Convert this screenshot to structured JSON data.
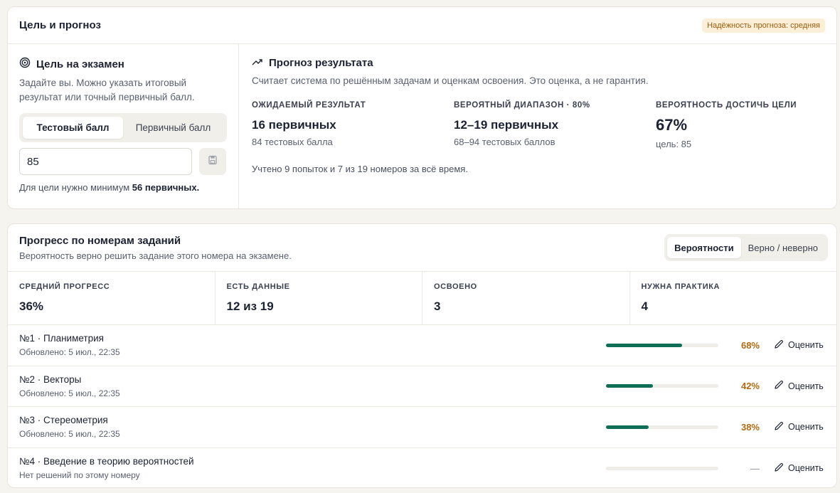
{
  "goal_card": {
    "title": "Цель и прогноз",
    "reliability_badge": "Надёжность прогноза: средняя"
  },
  "goal": {
    "title": "Цель на экзамен",
    "description": "Задайте вы. Можно указать итоговый результат или точный первичный балл.",
    "tabs": [
      {
        "label": "Тестовый балл",
        "active": true
      },
      {
        "label": "Первичный балл",
        "active": false
      }
    ],
    "input_value": "85",
    "hint_prefix": "Для цели нужно минимум",
    "hint_value": "56 первичных."
  },
  "forecast": {
    "title": "Прогноз результата",
    "description": "Считает система по решённым задачам и оценкам освоения. Это оценка, а не гарантия.",
    "stats": [
      {
        "label": "ОЖИДАЕМЫЙ РЕЗУЛЬТАТ",
        "value": "16 первичных",
        "sub": "84 тестовых балла"
      },
      {
        "label": "ВЕРОЯТНЫЙ ДИАПАЗОН · 80%",
        "value": "12–19 первичных",
        "sub": "68–94 тестовых баллов"
      },
      {
        "label": "ВЕРОЯТНОСТЬ ДОСТИЧЬ ЦЕЛИ",
        "value": "67%",
        "sub": "цель: 85"
      }
    ],
    "note": "Учтено 9 попыток и 7 из 19 номеров за всё время."
  },
  "progress": {
    "title": "Прогресс по номерам заданий",
    "description": "Вероятность верно решить задание этого номера на экзамене.",
    "toggle": [
      {
        "label": "Вероятности",
        "active": true
      },
      {
        "label": "Верно / неверно",
        "active": false
      }
    ],
    "summary": [
      {
        "label": "СРЕДНИЙ ПРОГРЕСС",
        "value": "36%"
      },
      {
        "label": "ЕСТЬ ДАННЫЕ",
        "value": "12 из 19"
      },
      {
        "label": "ОСВОЕНО",
        "value": "3"
      },
      {
        "label": "НУЖНА ПРАКТИКА",
        "value": "4"
      }
    ],
    "rate_label": "Оценить",
    "tasks": [
      {
        "name": "№1 · Планиметрия",
        "sub": "Обновлено: 5 июл., 22:35",
        "percent": 68,
        "percent_label": "68%"
      },
      {
        "name": "№2 · Векторы",
        "sub": "Обновлено: 5 июл., 22:35",
        "percent": 42,
        "percent_label": "42%"
      },
      {
        "name": "№3 · Стереометрия",
        "sub": "Обновлено: 5 июл., 22:35",
        "percent": 38,
        "percent_label": "38%"
      },
      {
        "name": "№4 · Введение в теорию вероятностей",
        "sub": "Нет решений по этому номеру",
        "percent": null,
        "percent_label": "—"
      }
    ]
  },
  "colors": {
    "accent_green": "#0f6e56",
    "percent_orange": "#b06a10",
    "badge_bg": "#fbefd8"
  }
}
